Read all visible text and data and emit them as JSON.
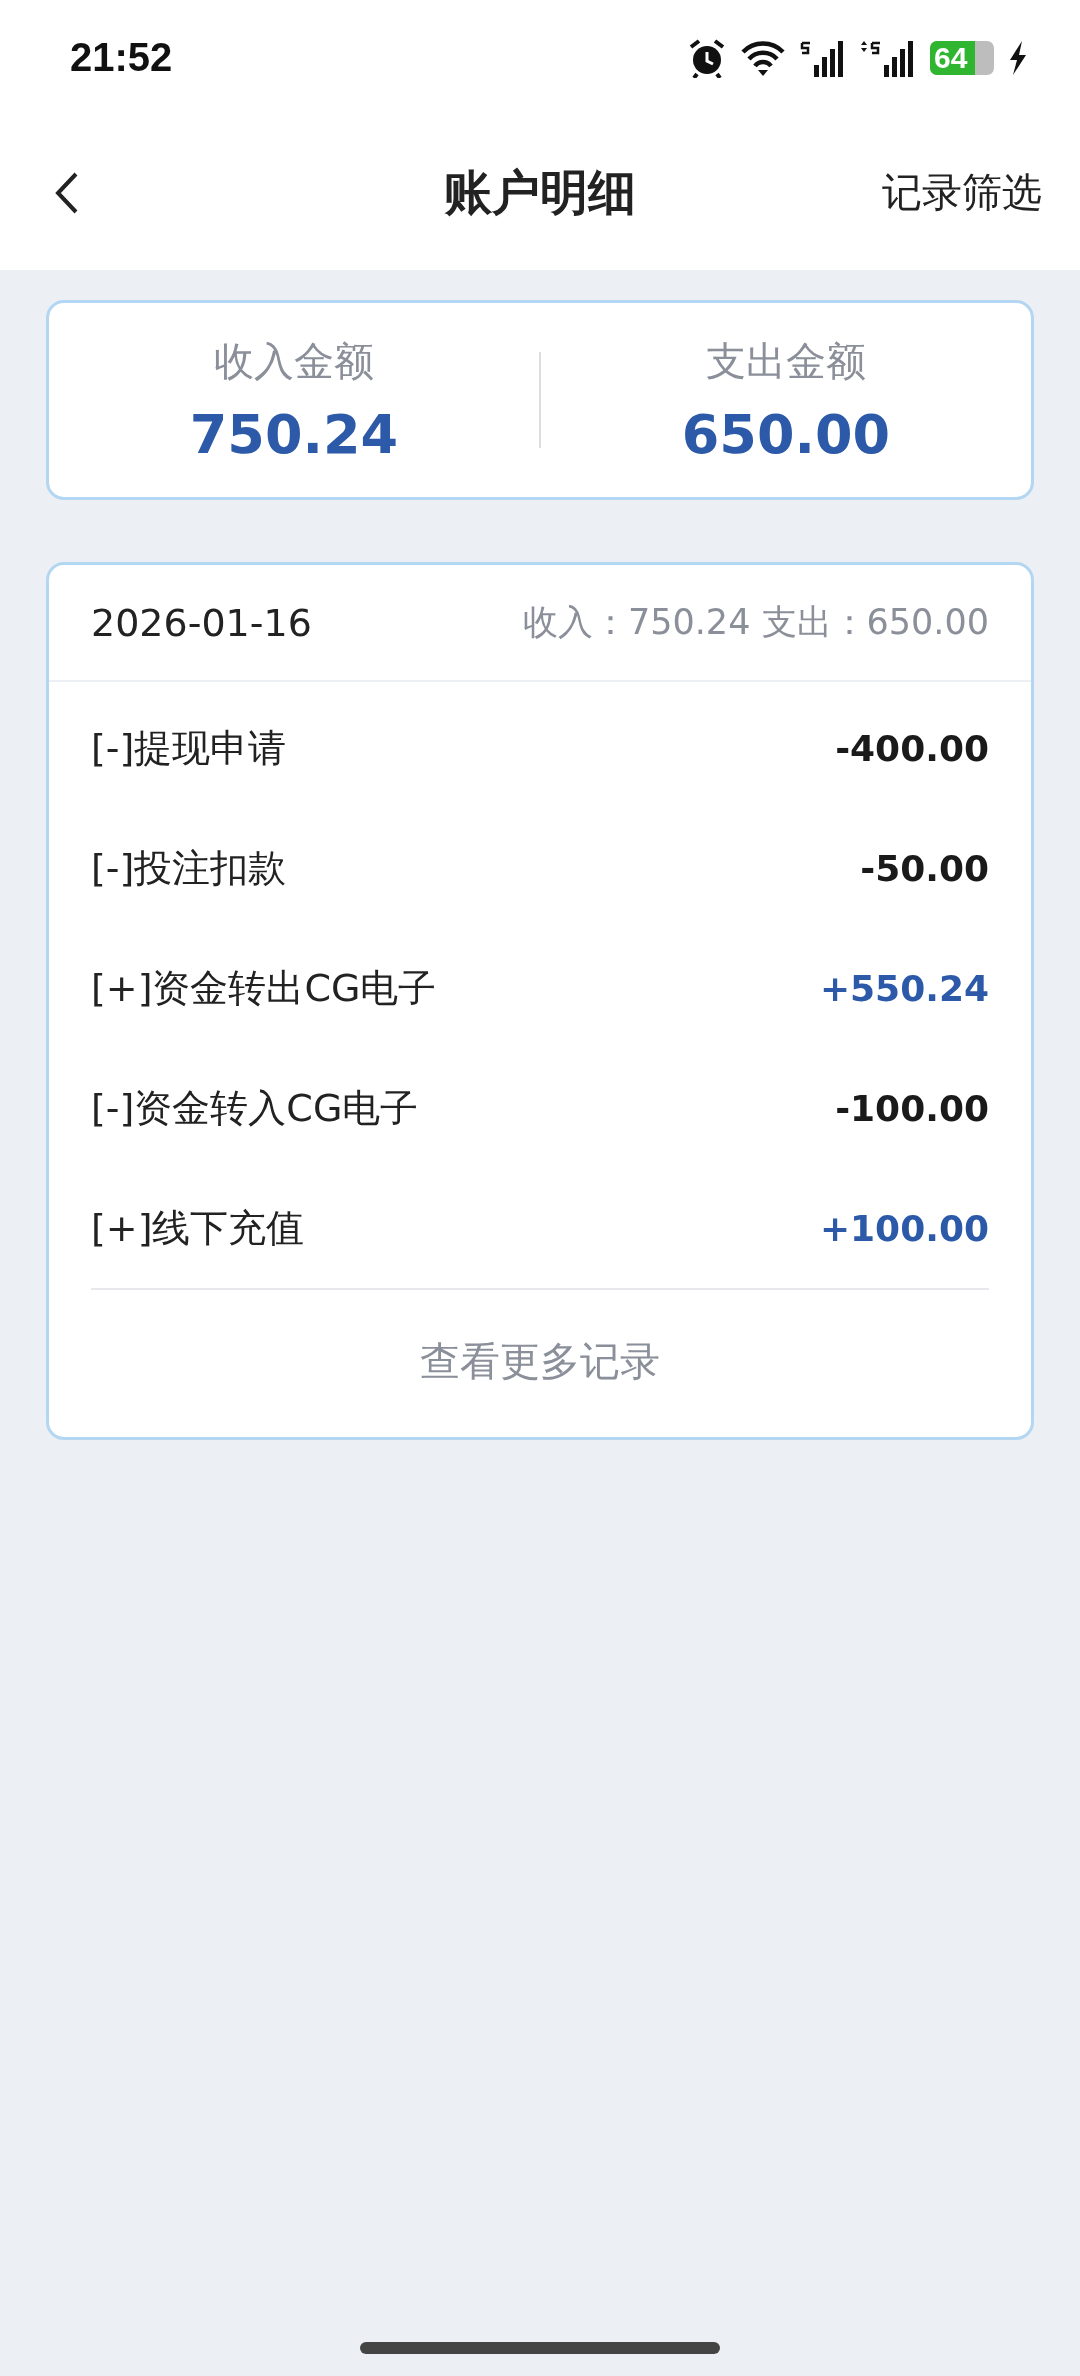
{
  "status_bar": {
    "time": "21:52",
    "battery": "64"
  },
  "nav": {
    "title": "账户明细",
    "action": "记录筛选"
  },
  "summary": [
    {
      "label": "收入金额",
      "amount": "750.24"
    },
    {
      "label": "支出金额",
      "amount": "650.00"
    }
  ],
  "day": {
    "date": "2026-01-16",
    "totals": "收入：750.24 支出：650.00",
    "records": [
      {
        "name": "[-]提现申请",
        "amount": "-400.00",
        "kind": "expense"
      },
      {
        "name": "[-]投注扣款",
        "amount": "-50.00",
        "kind": "expense"
      },
      {
        "name": "[+]资金转出CG电子",
        "amount": "+550.24",
        "kind": "income"
      },
      {
        "name": "[-]资金转入CG电子",
        "amount": "-100.00",
        "kind": "expense"
      },
      {
        "name": "[+]线下充值",
        "amount": "+100.00",
        "kind": "income"
      }
    ],
    "more": "查看更多记录"
  }
}
